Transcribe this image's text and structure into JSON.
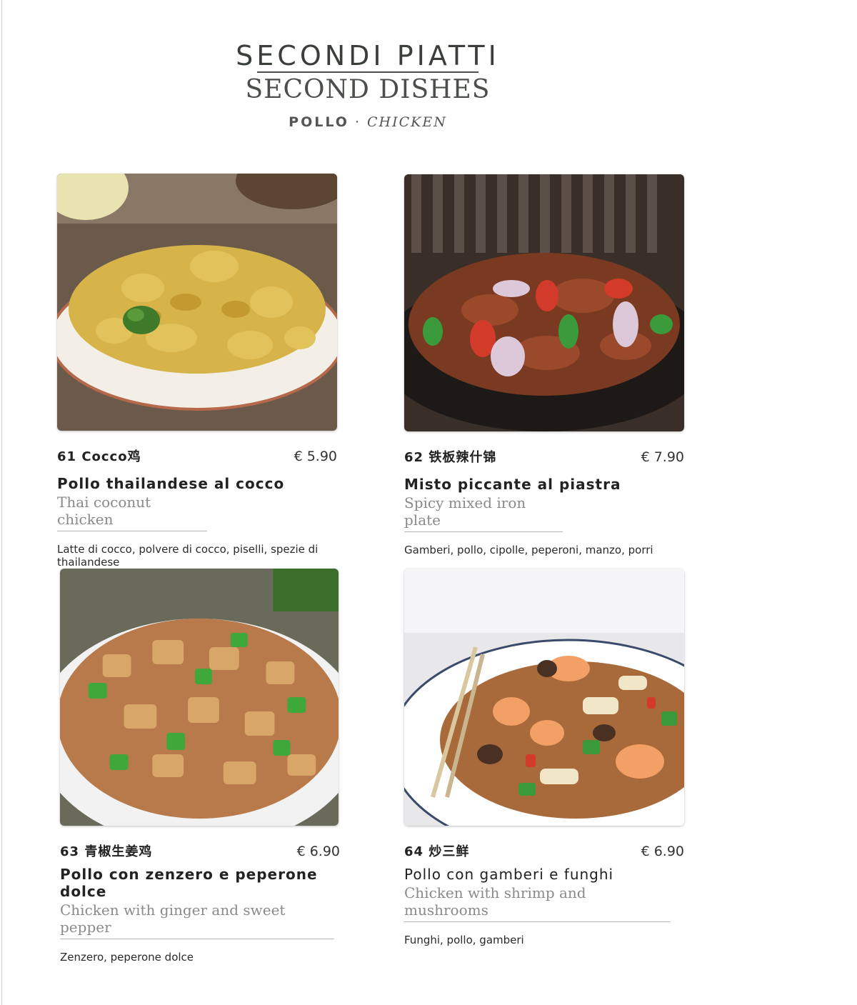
{
  "header": {
    "title_it": "SECONDI PIATTI",
    "title_en": "SECOND DISHES",
    "category_it": "POLLO",
    "separator": "·",
    "category_en": "CHICKEN"
  },
  "currency": "€",
  "dishes": [
    {
      "number_label": "61 Cocco鸡",
      "price": "€ 5.90",
      "name_it": "Pollo thailandese al cocco",
      "name_en": "Thai coconut chicken",
      "ingredients": "Latte di cocco, polvere di cocco, piselli, spezie di thailandese",
      "photo": "coconut-curry-chicken-plate"
    },
    {
      "number_label": "62 铁板辣什锦",
      "price": "€ 7.90",
      "name_it": "Misto piccante al piastra",
      "name_en": "Spicy mixed iron plate",
      "ingredients": "Gamberi, pollo, cipolle, peperoni, manzo, porri",
      "photo": "sizzling-iron-plate-mix"
    },
    {
      "number_label": "63 青椒生姜鸡",
      "price": "€ 6.90",
      "name_it": "Pollo con zenzero e peperone dolce",
      "name_en": "Chicken with ginger and sweet pepper",
      "ingredients": "Zenzero, peperone dolce",
      "photo": "chicken-green-pepper-bowl"
    },
    {
      "number_label": "64 炒三鲜",
      "price": "€ 6.90",
      "name_it": "Pollo con gamberi e funghi",
      "name_en": "Chicken with shrimp and mushrooms",
      "ingredients": "Funghi, pollo, gamberi",
      "photo": "shrimp-mushroom-stirfry-plate"
    }
  ]
}
